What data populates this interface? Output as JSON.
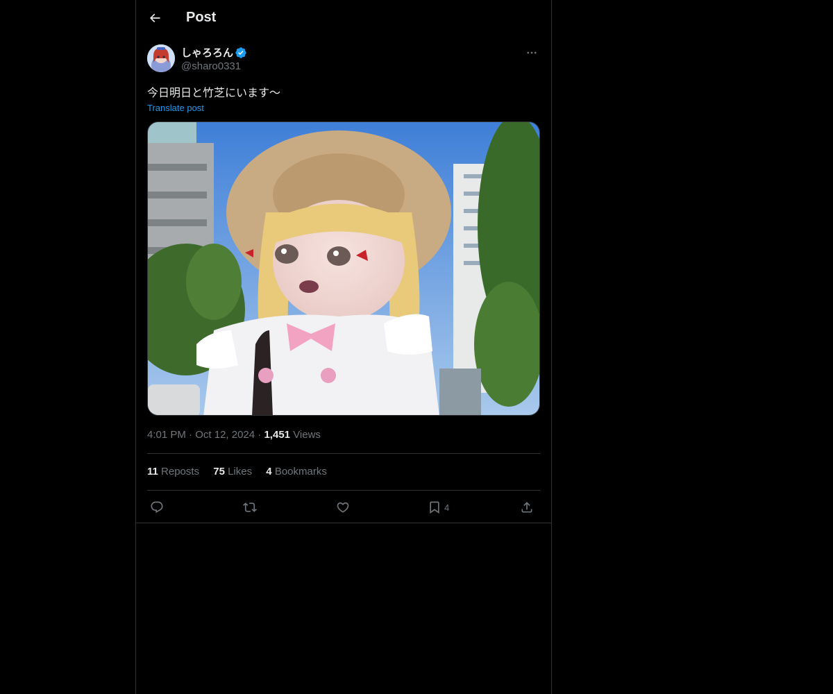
{
  "header": {
    "title": "Post"
  },
  "post": {
    "author": {
      "display_name": "しゃろろん",
      "handle": "@sharo0331",
      "verified": true
    },
    "text": "今日明日と竹芝にいます〜",
    "translate_label": "Translate post",
    "meta": {
      "time": "4:01 PM",
      "date": "Oct 12, 2024",
      "views_count": "1,451",
      "views_label": "Views"
    },
    "stats": {
      "reposts_count": "11",
      "reposts_label": "Reposts",
      "likes_count": "75",
      "likes_label": "Likes",
      "bookmarks_count": "4",
      "bookmarks_label": "Bookmarks"
    },
    "actions": {
      "bookmark_count": "4"
    }
  },
  "colors": {
    "background": "#000000",
    "text_primary": "#e7e9ea",
    "text_secondary": "#71767b",
    "accent": "#1d9bf0",
    "border": "#2f3336"
  },
  "icons": {
    "back": "arrow-left-icon",
    "verified": "verified-badge-icon",
    "more": "more-horizontal-icon",
    "reply": "reply-icon",
    "repost": "repost-icon",
    "like": "heart-icon",
    "bookmark": "bookmark-icon",
    "share": "share-icon"
  }
}
